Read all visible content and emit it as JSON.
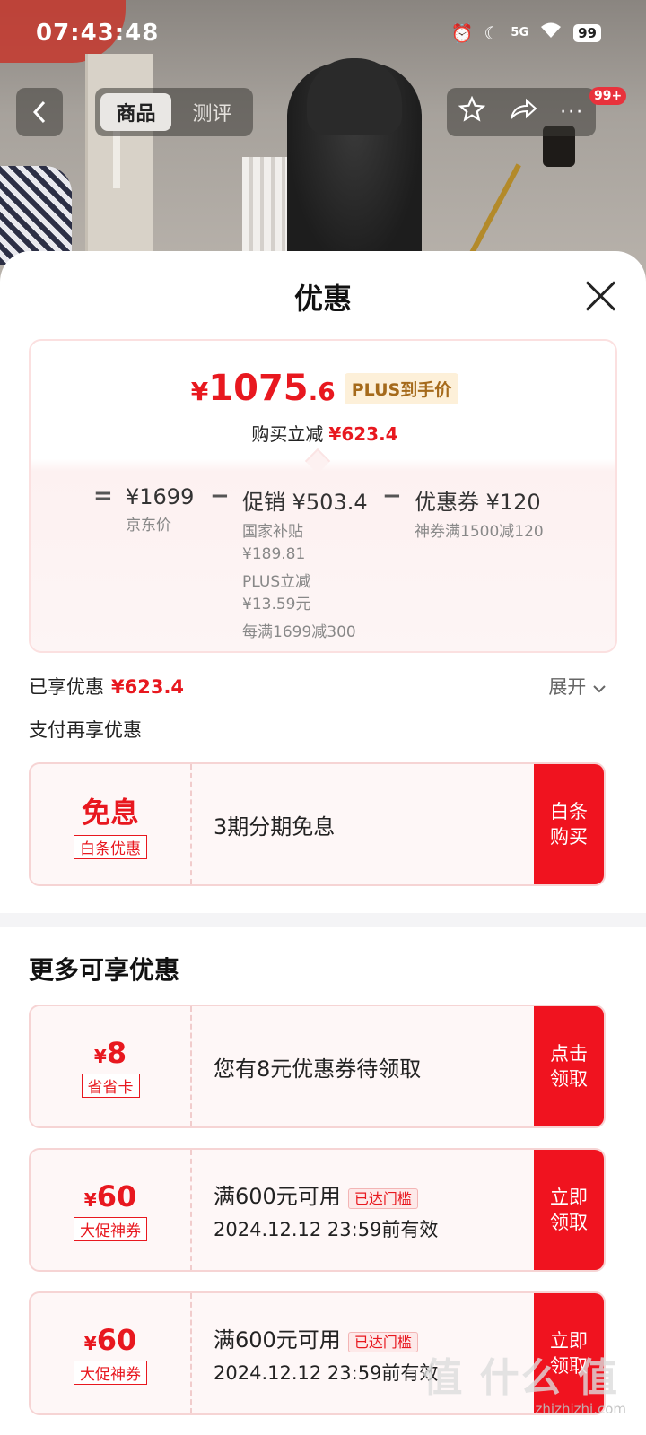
{
  "status_bar": {
    "time": "07:43:48",
    "signal": "5G",
    "battery": "99"
  },
  "top_nav": {
    "tabs": [
      {
        "label": "商品",
        "active": true
      },
      {
        "label": "测评",
        "active": false
      }
    ],
    "badge": "99+"
  },
  "sheet": {
    "title": "优惠",
    "final_price": {
      "currency": "¥",
      "integer": "1075",
      "decimal": ".6",
      "tag": "PLUS到手价"
    },
    "saving": {
      "label": "购买立减",
      "amount": "¥623.4"
    },
    "breakdown": {
      "eq": "=",
      "base": {
        "amount": "¥1699",
        "label": "京东价"
      },
      "minus1": "−",
      "promo": {
        "title": "促销 ¥503.4",
        "details": [
          "国家补贴",
          "¥189.81",
          "PLUS立减",
          "¥13.59元",
          "每满1699减300"
        ]
      },
      "minus2": "−",
      "coupon": {
        "title": "优惠券 ¥120",
        "detail": "神券满1500减120"
      }
    },
    "enjoyed": {
      "label": "已享优惠",
      "amount": "¥623.4",
      "expand": "展开"
    },
    "pay_more_title": "支付再享优惠",
    "pay_coupon": {
      "value": "免息",
      "tag": "白条优惠",
      "text": "3期分期免息",
      "cta": "白条购买"
    },
    "more_title": "更多可享优惠",
    "more_coupons": [
      {
        "currency": "¥",
        "value": "8",
        "tag": "省省卡",
        "line1": "您有8元优惠券待领取",
        "line2": "",
        "reached": "",
        "cta": "点击领取"
      },
      {
        "currency": "¥",
        "value": "60",
        "tag": "大促神券",
        "line1": "满600元可用",
        "reached": "已达门槛",
        "line2": "2024.12.12 23:59前有效",
        "cta": "立即领取"
      },
      {
        "currency": "¥",
        "value": "60",
        "tag": "大促神券",
        "line1": "满600元可用",
        "reached": "已达门槛",
        "line2": "2024.12.12 23:59前有效",
        "cta": "立即领取"
      }
    ]
  },
  "watermark": {
    "text": "值 什么 值",
    "url": "zhizhizhi.com"
  },
  "colors": {
    "accent": "#f0131f",
    "price_red": "#e8181f",
    "plus_gold": "#a56a1b"
  }
}
